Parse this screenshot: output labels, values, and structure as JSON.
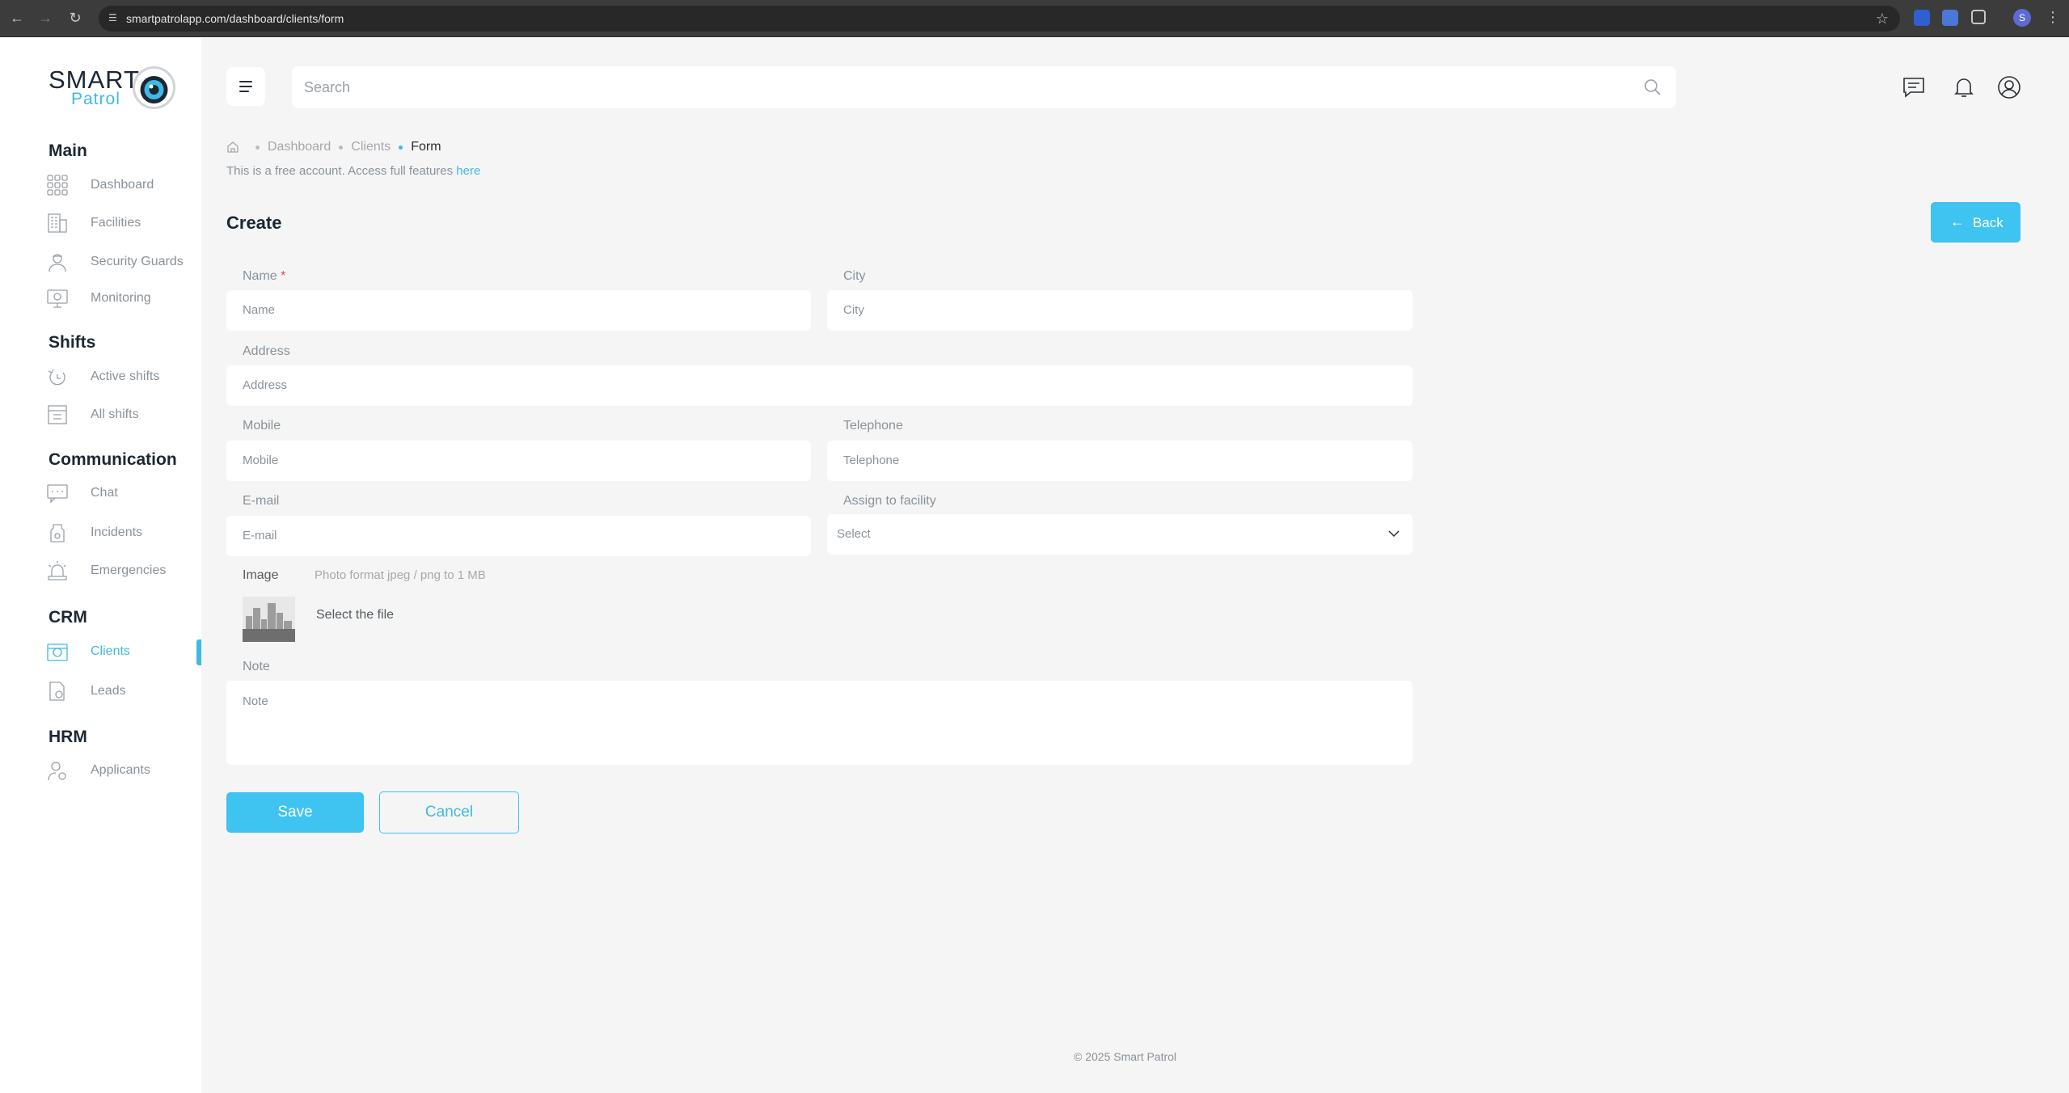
{
  "browser": {
    "url": "smartpatrolapp.com/dashboard/clients/form",
    "profile_initial": "S"
  },
  "logo": {
    "smart": "SMART",
    "patrol": "Patrol"
  },
  "sidebar": {
    "sections": [
      {
        "title": "Main",
        "items": [
          {
            "label": "Dashboard",
            "icon": "dashboard-grid-icon"
          },
          {
            "label": "Facilities",
            "icon": "building-icon"
          },
          {
            "label": "Security Guards",
            "icon": "guard-icon"
          },
          {
            "label": "Monitoring",
            "icon": "monitor-icon"
          }
        ]
      },
      {
        "title": "Shifts",
        "items": [
          {
            "label": "Active shifts",
            "icon": "active-shift-icon"
          },
          {
            "label": "All shifts",
            "icon": "all-shifts-icon"
          }
        ]
      },
      {
        "title": "Communication",
        "items": [
          {
            "label": "Chat",
            "icon": "chat-icon"
          },
          {
            "label": "Incidents",
            "icon": "incident-icon"
          },
          {
            "label": "Emergencies",
            "icon": "alarm-icon"
          }
        ]
      },
      {
        "title": "CRM",
        "items": [
          {
            "label": "Clients",
            "icon": "clients-icon",
            "active": true
          },
          {
            "label": "Leads",
            "icon": "leads-icon"
          }
        ]
      },
      {
        "title": "HRM",
        "items": [
          {
            "label": "Applicants",
            "icon": "applicant-icon"
          }
        ]
      }
    ]
  },
  "topbar": {
    "search_placeholder": "Search"
  },
  "breadcrumb": {
    "items": [
      "Dashboard",
      "Clients"
    ],
    "current": "Form"
  },
  "notice": {
    "text": "This is a free account. Access full features ",
    "link": "here"
  },
  "page": {
    "title": "Create",
    "back_label": "Back"
  },
  "form": {
    "name": {
      "label": "Name",
      "placeholder": "Name",
      "required_mark": "*"
    },
    "city": {
      "label": "City",
      "placeholder": "City"
    },
    "address": {
      "label": "Address",
      "placeholder": "Address"
    },
    "mobile": {
      "label": "Mobile",
      "placeholder": "Mobile"
    },
    "telephone": {
      "label": "Telephone",
      "placeholder": "Telephone"
    },
    "email": {
      "label": "E-mail",
      "placeholder": "E-mail"
    },
    "facility": {
      "label": "Assign to facility",
      "selected": "Select"
    },
    "image": {
      "label": "Image",
      "hint": "Photo format jpeg / png to 1 MB",
      "select_text": "Select the file"
    },
    "note": {
      "label": "Note",
      "placeholder": "Note"
    },
    "save_label": "Save",
    "cancel_label": "Cancel"
  },
  "footer": {
    "text": "© 2025 Smart Patrol"
  },
  "colors": {
    "accent": "#3fc3f0",
    "sidebar_bg": "#ffffff",
    "content_bg": "#f5f5f5"
  }
}
